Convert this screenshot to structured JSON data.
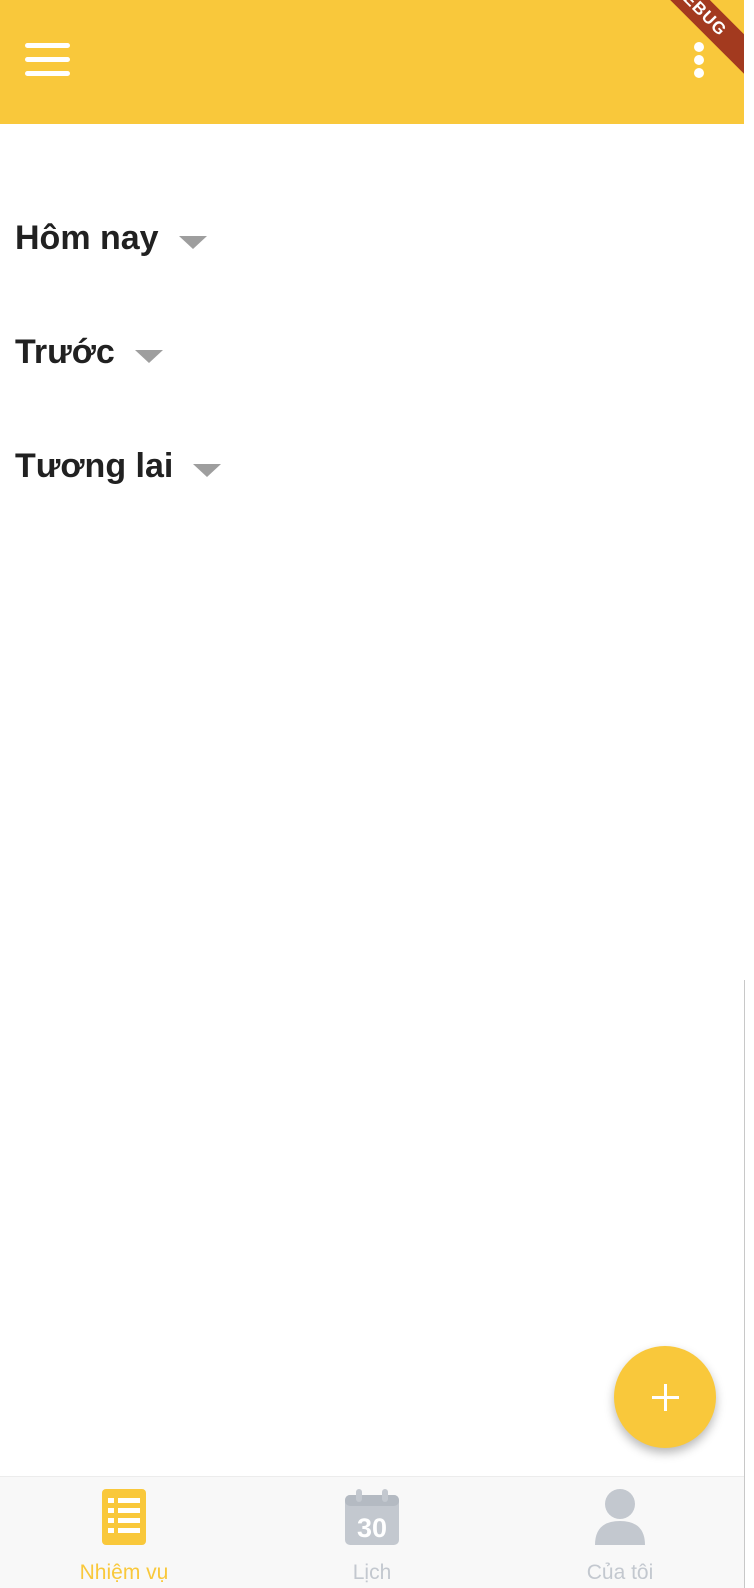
{
  "app_bar": {
    "menu_icon": "hamburger-menu-icon",
    "more_icon": "more-vertical-icon",
    "debug_banner": "DEBUG",
    "background_color": "#F9C83B"
  },
  "sections": [
    {
      "title": "Hôm nay",
      "icon": "caret-down-icon"
    },
    {
      "title": "Trước",
      "icon": "caret-down-icon"
    },
    {
      "title": "Tương lai",
      "icon": "caret-down-icon"
    }
  ],
  "fab": {
    "icon": "plus-icon",
    "color": "#F9C83B"
  },
  "bottom_nav": {
    "items": [
      {
        "label": "Nhiệm vụ",
        "icon": "task-list-icon",
        "active": true
      },
      {
        "label": "Lịch",
        "icon": "calendar-icon",
        "icon_text": "30",
        "active": false
      },
      {
        "label": "Của tôi",
        "icon": "user-icon",
        "active": false
      }
    ],
    "active_color": "#F9C83B",
    "inactive_color": "#C3C8CF"
  }
}
